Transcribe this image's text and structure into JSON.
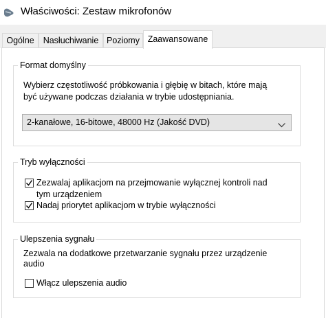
{
  "window": {
    "title": "Właściwości: Zestaw mikrofonów",
    "icon": "microphone-headset-icon"
  },
  "tabs": [
    {
      "label": "Ogólne",
      "active": false
    },
    {
      "label": "Nasłuchiwanie",
      "active": false
    },
    {
      "label": "Poziomy",
      "active": false
    },
    {
      "label": "Zaawansowane",
      "active": true
    }
  ],
  "default_format": {
    "title": "Format domyślny",
    "description_line1": "Wybierz częstotliwość próbkowania i głębię w bitach, które mają",
    "description_line2": "być używane podczas działania w trybie udostępniania.",
    "selected": "2-kanałowe, 16-bitowe, 48000 Hz (Jakość DVD)"
  },
  "exclusive_mode": {
    "title": "Tryb wyłączności",
    "allow_exclusive_line1": "Zezwalaj aplikacjom na przejmowanie wyłącznej kontroli nad",
    "allow_exclusive_line2": "tym urządzeniem",
    "allow_exclusive_checked": true,
    "priority_label": "Nadaj priorytet aplikacjom w trybie wyłączności",
    "priority_checked": true
  },
  "enhancements": {
    "title": "Ulepszenia sygnału",
    "description_line1": "Zezwala na dodatkowe przetwarzanie sygnału przez urządzenie",
    "description_line2": "audio",
    "enable_label": "Włącz ulepszenia audio",
    "enable_checked": false
  }
}
